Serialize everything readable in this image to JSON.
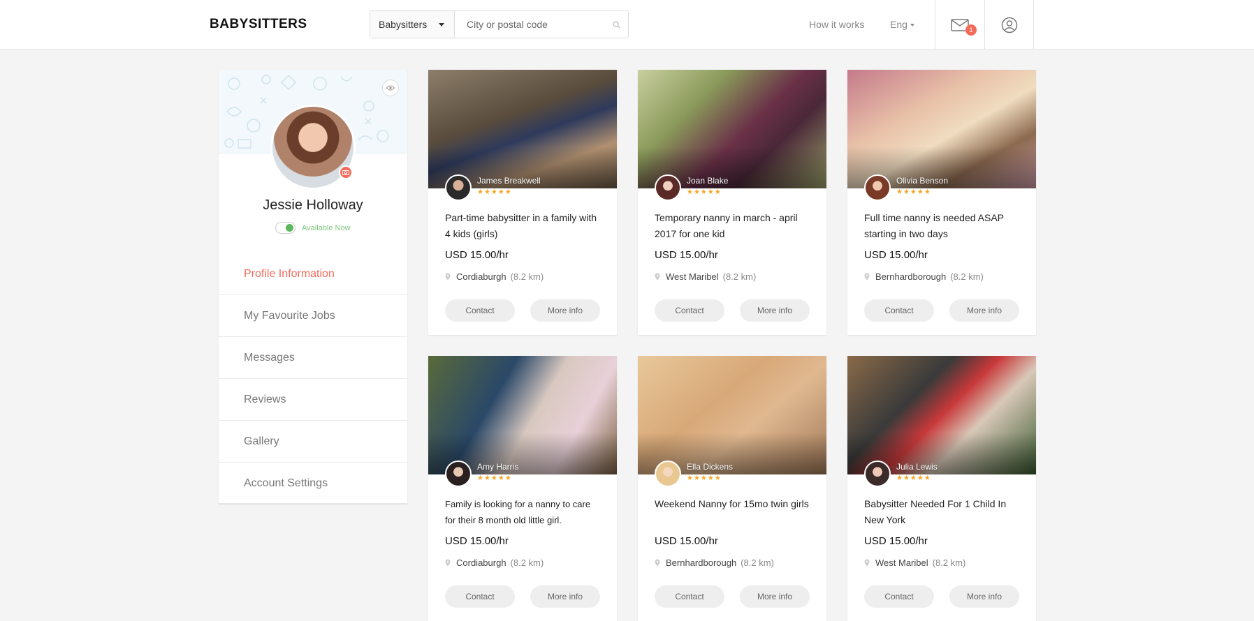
{
  "header": {
    "logo": "BABYSITTERS",
    "search": {
      "category": "Babysitters",
      "location_placeholder": "City or postal code"
    },
    "how_it_works": "How it works",
    "language": "Eng",
    "messages_badge": "1"
  },
  "sidebar": {
    "name": "Jessie Holloway",
    "availability": "Available Now",
    "menu": [
      {
        "label": "Profile Information"
      },
      {
        "label": "My Favourite Jobs"
      },
      {
        "label": "Messages"
      },
      {
        "label": "Reviews"
      },
      {
        "label": "Gallery"
      },
      {
        "label": "Account Settings"
      }
    ]
  },
  "jobs": [
    {
      "poster": "James Breakwell",
      "stars": "★★★★★",
      "title": "Part-time babysitter in a family with 4 kids (girls)",
      "price": "USD 15.00/hr",
      "location": "Cordiaburgh",
      "distance": "(8.2 km)",
      "contact": "Contact",
      "more": "More info"
    },
    {
      "poster": "Joan Blake",
      "stars": "★★★★★",
      "title": "Temporary nanny in march - april 2017 for one kid",
      "price": "USD 15.00/hr",
      "location": "West Maribel",
      "distance": "(8.2 km)",
      "contact": "Contact",
      "more": "More info"
    },
    {
      "poster": "Olivia Benson",
      "stars": "★★★★★",
      "title": "Full time nanny is needed ASAP starting in two days",
      "price": "USD 15.00/hr",
      "location": "Bernhardborough",
      "distance": "(8.2 km)",
      "contact": "Contact",
      "more": "More info"
    },
    {
      "poster": "Amy Harris",
      "stars": "★★★★★",
      "title": "Family is looking for a nanny to care for their 8 month old little girl.",
      "price": "USD 15.00/hr",
      "location": "Cordiaburgh",
      "distance": "(8.2 km)",
      "contact": "Contact",
      "more": "More info"
    },
    {
      "poster": "Ella Dickens",
      "stars": "★★★★★",
      "title": "Weekend Nanny for 15mo twin girls",
      "price": "USD 15.00/hr",
      "location": "Bernhardborough",
      "distance": "(8.2 km)",
      "contact": "Contact",
      "more": "More info"
    },
    {
      "poster": "Julia Lewis",
      "stars": "★★★★★",
      "title": "Babysitter Needed For 1 Child In New York",
      "price": "USD 15.00/hr",
      "location": "West Maribel",
      "distance": "(8.2 km)",
      "contact": "Contact",
      "more": "More info"
    }
  ],
  "colors": {
    "accent": "#f26b5b",
    "available": "#5cb85c",
    "stars": "#f5a623"
  }
}
